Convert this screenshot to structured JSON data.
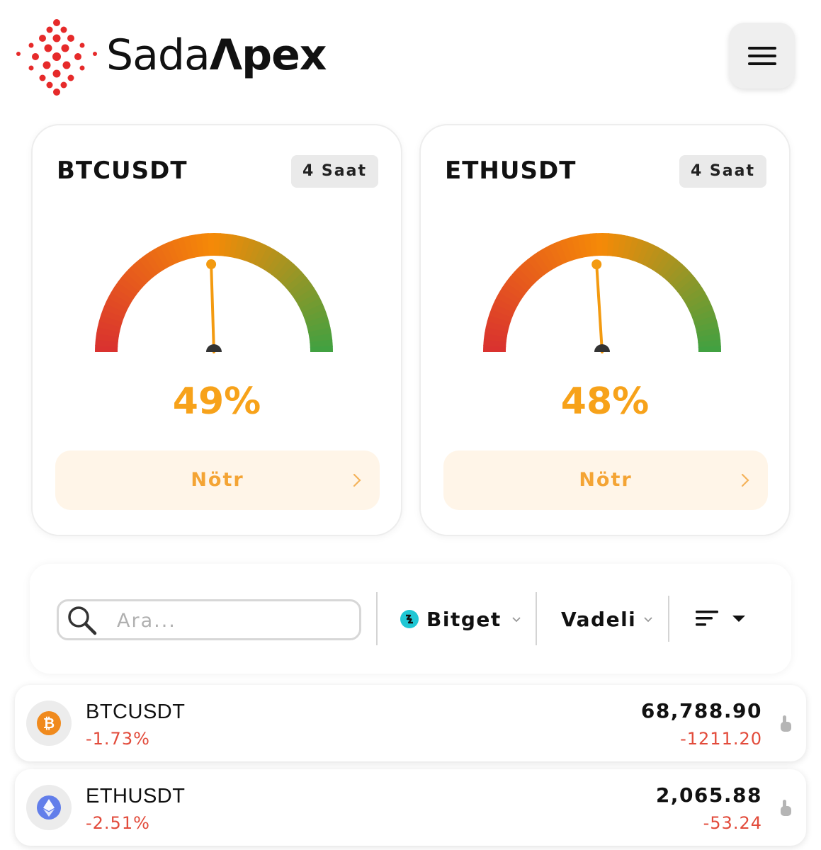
{
  "brand": {
    "name_part1": "Sada",
    "name_part2": "Λpex",
    "accent": "#e62a2a"
  },
  "header": {
    "menu_icon": "hamburger-menu-icon"
  },
  "sentiment_cards": [
    {
      "symbol": "BTCUSDT",
      "timeframe": "4 Saat",
      "percent": 49,
      "percent_label": "49%",
      "status": "Nötr",
      "status_color": "#f4a434"
    },
    {
      "symbol": "ETHUSDT",
      "timeframe": "4 Saat",
      "percent": 48,
      "percent_label": "48%",
      "status": "Nötr",
      "status_color": "#f4a434"
    }
  ],
  "gauge_colors": {
    "low": "#d93030",
    "mid": "#f58a07",
    "high": "#3fa142",
    "needle": "#f39a10",
    "pivot": "#333333"
  },
  "filters": {
    "search_placeholder": "Ara...",
    "search_icon": "search-icon",
    "exchange": "Bitget",
    "market": "Vadeli",
    "sort_icon": "sort-icon"
  },
  "tickers": [
    {
      "symbol": "BTCUSDT",
      "change_pct": "-1.73%",
      "price": "68,788.90",
      "change_abs": "-1211.20",
      "icon": "bitcoin-icon"
    },
    {
      "symbol": "ETHUSDT",
      "change_pct": "-2.51%",
      "price": "2,065.88",
      "change_abs": "-53.24",
      "icon": "ethereum-icon"
    }
  ]
}
